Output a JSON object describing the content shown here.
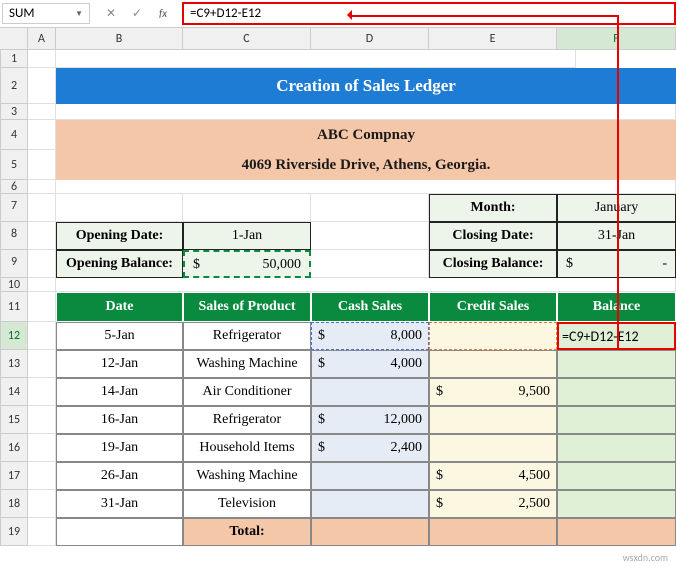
{
  "nameBox": "SUM",
  "formula": "=C9+D12-E12",
  "columns": [
    "A",
    "B",
    "C",
    "D",
    "E",
    "F"
  ],
  "activeCol": "F",
  "activeRow": "12",
  "title": "Creation of Sales Ledger",
  "company": {
    "name": "ABC Compnay",
    "address": "4069 Riverside Drive, Athens, Georgia."
  },
  "labels": {
    "month": "Month:",
    "openingDate": "Opening Date:",
    "closingDate": "Closing Date:",
    "openingBalance": "Opening Balance:",
    "closingBalance": "Closing Balance:"
  },
  "values": {
    "month": "January",
    "openingDate": "1-Jan",
    "closingDate": "31-Jan",
    "openingBalanceCur": "$",
    "openingBalanceVal": "50,000",
    "closingBalanceCur": "$",
    "closingBalanceVal": "-"
  },
  "headers": {
    "date": "Date",
    "product": "Sales of Product",
    "cash": "Cash Sales",
    "credit": "Credit Sales",
    "balance": "Balance"
  },
  "rows": [
    {
      "date": "5-Jan",
      "product": "Refrigerator",
      "cashCur": "$",
      "cashVal": "8,000",
      "creditCur": "",
      "creditVal": "",
      "bal": "=C9+D12-E12"
    },
    {
      "date": "12-Jan",
      "product": "Washing Machine",
      "cashCur": "$",
      "cashVal": "4,000",
      "creditCur": "",
      "creditVal": "",
      "bal": ""
    },
    {
      "date": "14-Jan",
      "product": "Air Conditioner",
      "cashCur": "",
      "cashVal": "",
      "creditCur": "$",
      "creditVal": "9,500",
      "bal": ""
    },
    {
      "date": "16-Jan",
      "product": "Refrigerator",
      "cashCur": "$",
      "cashVal": "12,000",
      "creditCur": "",
      "creditVal": "",
      "bal": ""
    },
    {
      "date": "19-Jan",
      "product": "Household Items",
      "cashCur": "$",
      "cashVal": "2,400",
      "creditCur": "",
      "creditVal": "",
      "bal": ""
    },
    {
      "date": "26-Jan",
      "product": "Washing Machine",
      "cashCur": "",
      "cashVal": "",
      "creditCur": "$",
      "creditVal": "4,500",
      "bal": ""
    },
    {
      "date": "31-Jan",
      "product": "Television",
      "cashCur": "",
      "cashVal": "",
      "creditCur": "$",
      "creditVal": "2,500",
      "bal": ""
    }
  ],
  "totalLabel": "Total:",
  "watermark": "wsxdn.com"
}
